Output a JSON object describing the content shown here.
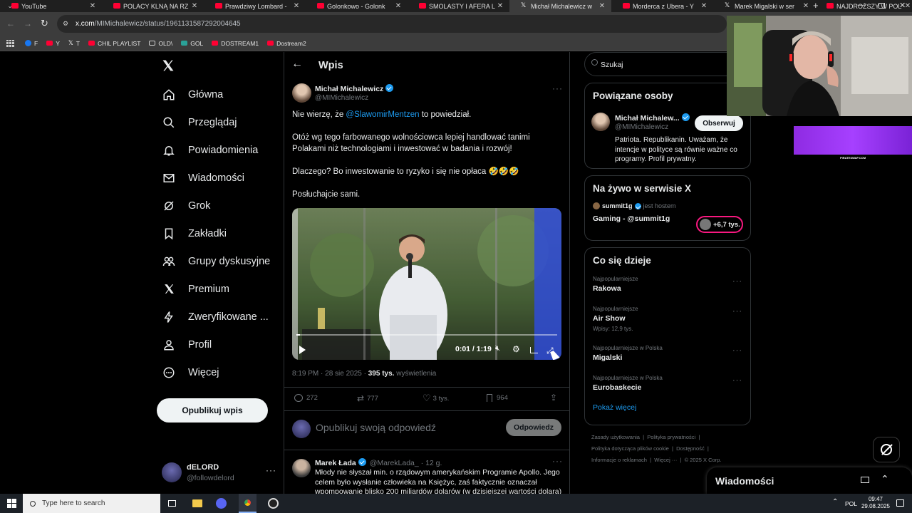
{
  "browser": {
    "tabs": [
      {
        "title": "YouTube",
        "icon": "youtube-icon",
        "active": false
      },
      {
        "title": "POLACY KLNĄ NA RZ",
        "icon": "youtube-icon",
        "active": false
      },
      {
        "title": "Prawdziwy Lombard -",
        "icon": "youtube-icon",
        "active": false
      },
      {
        "title": "Golonkowo - Golonk",
        "icon": "youtube-icon",
        "active": false
      },
      {
        "title": "SMOLASTY I AFERA L",
        "icon": "youtube-icon",
        "active": false
      },
      {
        "title": "Michał Michalewicz w",
        "icon": "x-icon",
        "active": true
      },
      {
        "title": "Morderca z Ubera - Y",
        "icon": "youtube-icon",
        "active": false
      },
      {
        "title": "Marek Migalski w ser",
        "icon": "x-icon",
        "active": false
      },
      {
        "title": "NAJDROŻSZY W POL",
        "icon": "youtube-icon",
        "active": false
      }
    ],
    "url_host": "x.com",
    "url_path": "/MIMichalewicz/status/1961131587292004645",
    "bookmarks": [
      "F",
      "Y",
      "T",
      "CHIL PLAYLIST",
      "OLD\\",
      "GOL",
      "DOSTREAM1",
      "Dostream2"
    ]
  },
  "nav": {
    "items": [
      {
        "label": "Główna",
        "icon": "home-icon"
      },
      {
        "label": "Przeglądaj",
        "icon": "search-icon"
      },
      {
        "label": "Powiadomienia",
        "icon": "bell-icon"
      },
      {
        "label": "Wiadomości",
        "icon": "envelope-icon"
      },
      {
        "label": "Grok",
        "icon": "grok-icon"
      },
      {
        "label": "Zakładki",
        "icon": "bookmark-icon"
      },
      {
        "label": "Grupy dyskusyjne",
        "icon": "people-icon"
      },
      {
        "label": "Premium",
        "icon": "x-logo-icon"
      },
      {
        "label": "Zweryfikowane ...",
        "icon": "lightning-icon"
      },
      {
        "label": "Profil",
        "icon": "person-icon"
      },
      {
        "label": "Więcej",
        "icon": "more-circle-icon"
      }
    ],
    "post_button": "Opublikuj wpis",
    "account": {
      "name": "dELORD",
      "handle": "@followdelord"
    }
  },
  "main": {
    "header_title": "Wpis",
    "author_name": "Michał Michalewicz",
    "author_handle": "@MIMichalewicz",
    "text_p1_prefix": "Nie wierzę, że ",
    "text_p1_mention": "@SlawomirMentzen",
    "text_p1_suffix": " to powiedział.",
    "text_p2": "Otóż wg tego farbowanego wolnościowca lepiej handlować tanimi Polakami niż technologiami i inwestować w badania i rozwój!",
    "text_p3": "Dlaczego? Bo inwestowanie to ryzyko i się nie opłaca 🤣🤣🤣",
    "text_p4": "Posłuchajcie sami.",
    "video_time": "0:01 / 1:19",
    "video_progress": 0.013,
    "meta_time": "8:19 PM · 28 sie 2025 · ",
    "meta_views": "395 tys.",
    "meta_views_label": " wyświetlenia",
    "stats": {
      "replies": "272",
      "reposts": "777",
      "likes": "3 tys.",
      "bookmarks": "964"
    },
    "reply_placeholder": "Opublikuj swoją odpowiedź",
    "reply_button": "Odpowiedz",
    "reply": {
      "name": "Marek Łada",
      "handle": "@MarekLada_",
      "time": "· 12 g.",
      "text": "Młody nie słyszał min. o rządowym amerykańskim Programie Apollo. Jego celem było wysłanie człowieka na Księżyc, zaś faktycznie oznaczał wpompowanie blisko 200 miliardów dolarów (w dzisiejszej wartości dolara)"
    }
  },
  "side": {
    "search_placeholder": "Szukaj",
    "related_title": "Powiązane osoby",
    "related": {
      "name": "Michał Michalew...",
      "handle": "@MIMichalewicz",
      "follow": "Obserwuj",
      "bio": "Patriota. Republikanin. Uważam, że intencje w polityce są równie ważne co programy. Profil prywatny."
    },
    "live_title": "Na żywo w serwisie X",
    "live": {
      "host": "summit1g",
      "host_suffix": "jest hostem",
      "title": "Gaming - @summit1g",
      "count": "+6,7 tys."
    },
    "trends_title": "Co się dzieje",
    "trends": [
      {
        "category": "Najpopularniejsze",
        "title": "Rakowa",
        "posts": ""
      },
      {
        "category": "Najpopularniejsze",
        "title": "Air Show",
        "posts": "Wpisy: 12,9 tys."
      },
      {
        "category": "Najpopularniejsze w Polska",
        "title": "Migalski",
        "posts": ""
      },
      {
        "category": "Najpopularniejsze w Polska",
        "title": "Eurobaskecie",
        "posts": ""
      }
    ],
    "show_more": "Pokaż więcej",
    "footer": {
      "l1a": "Zasady użytkowania",
      "l1b": "Polityka prywatności",
      "l2a": "Polityka dotycząca plików cookie",
      "l2b": "Dostępność",
      "l3a": "Informacje o reklamach",
      "l3b": "Więcej ···",
      "l3c": "© 2025 X Corp."
    }
  },
  "messages_dock": "Wiadomości",
  "overlay": {
    "brand_text": "PIRATESWAP.COM"
  },
  "taskbar": {
    "search_placeholder": "Type here to search",
    "lang": "POL",
    "time": "09:47",
    "date": "29.08.2025"
  },
  "colors": {
    "accent": "#1d9bf0",
    "live": "#f91880",
    "youtube": "#ff0033"
  }
}
